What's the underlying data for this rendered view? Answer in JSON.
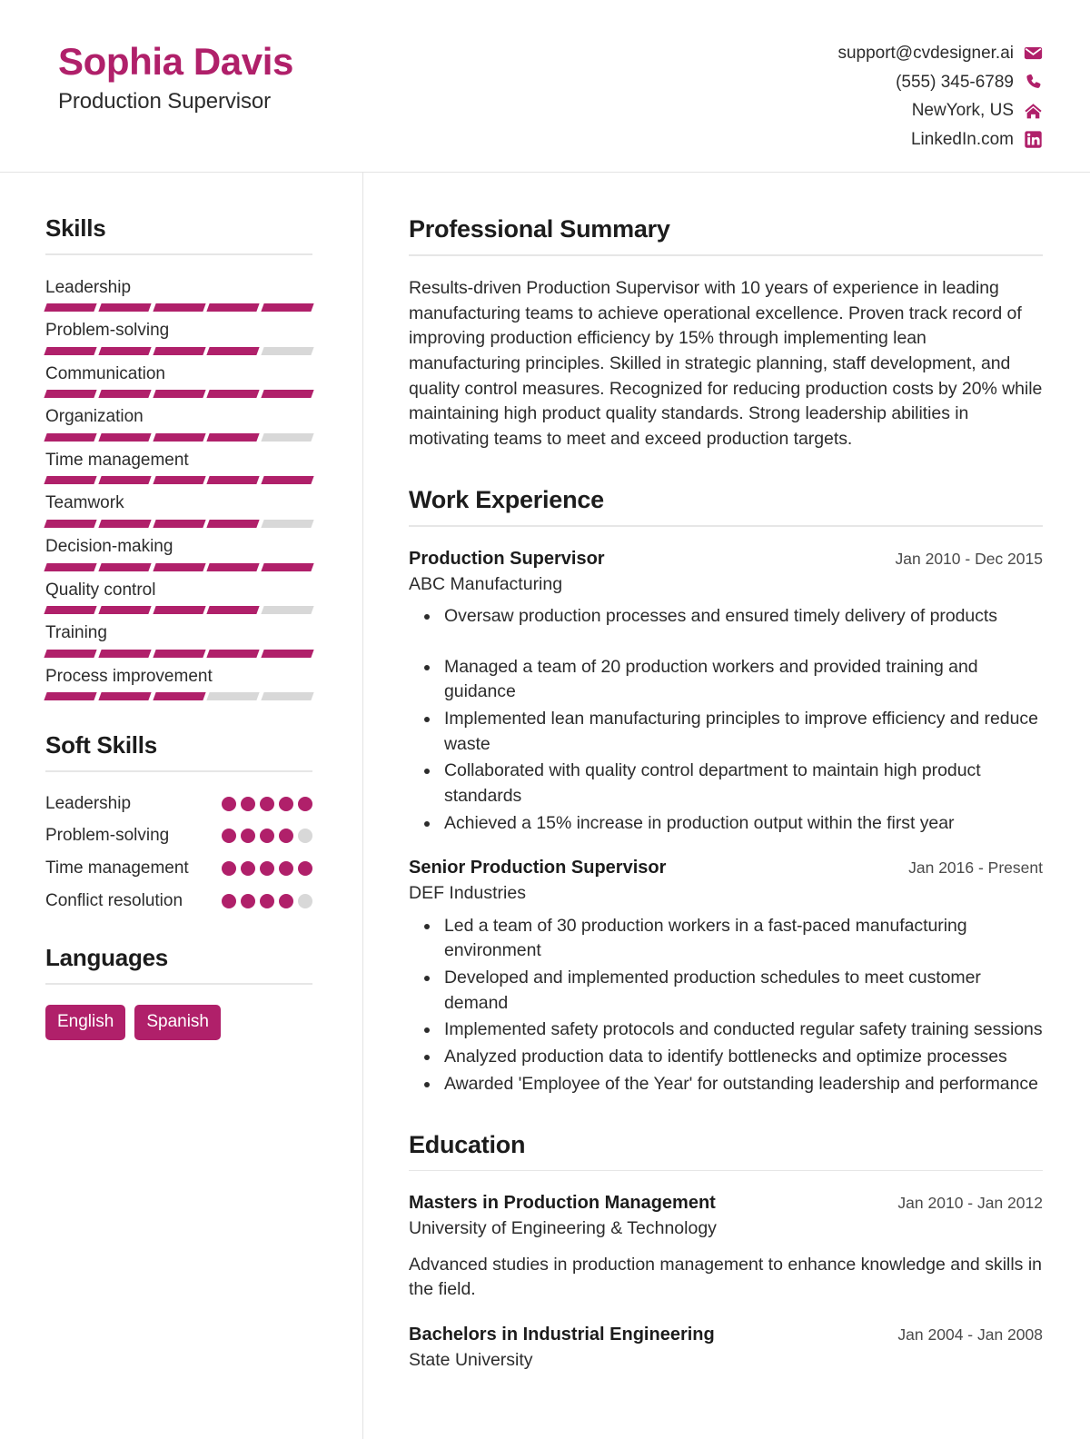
{
  "brand_color": "#b0206a",
  "muted_color": "#d8d8d8",
  "header": {
    "full_name": "Sophia Davis",
    "job_title": "Production Supervisor",
    "contacts": [
      {
        "text": "support@cvdesigner.ai",
        "icon": "envelope-icon"
      },
      {
        "text": "(555) 345-6789",
        "icon": "phone-icon"
      },
      {
        "text": "NewYork, US",
        "icon": "home-icon"
      },
      {
        "text": "LinkedIn.com",
        "icon": "linkedin-icon"
      }
    ]
  },
  "sidebar": {
    "skills": {
      "title": "Skills",
      "max_level": 5,
      "items": [
        {
          "label": "Leadership",
          "level": 5
        },
        {
          "label": "Problem-solving",
          "level": 4
        },
        {
          "label": "Communication",
          "level": 5
        },
        {
          "label": "Organization",
          "level": 4
        },
        {
          "label": "Time management",
          "level": 5
        },
        {
          "label": "Teamwork",
          "level": 4
        },
        {
          "label": "Decision-making",
          "level": 5
        },
        {
          "label": "Quality control",
          "level": 4
        },
        {
          "label": "Training",
          "level": 5
        },
        {
          "label": "Process improvement",
          "level": 3
        }
      ]
    },
    "soft_skills": {
      "title": "Soft Skills",
      "max_level": 5,
      "items": [
        {
          "label": "Leadership",
          "level": 5
        },
        {
          "label": "Problem-solving",
          "level": 4
        },
        {
          "label": "Time management",
          "level": 5
        },
        {
          "label": "Conflict resolution",
          "level": 4
        }
      ]
    },
    "languages": {
      "title": "Languages",
      "items": [
        "English",
        "Spanish"
      ]
    }
  },
  "main": {
    "summary": {
      "title": "Professional Summary",
      "text": "Results-driven Production Supervisor with 10 years of experience in leading manufacturing teams to achieve operational excellence. Proven track record of improving production efficiency by 15% through implementing lean manufacturing principles. Skilled in strategic planning, staff development, and quality control measures. Recognized for reducing production costs by 20% while maintaining high product quality standards. Strong leadership abilities in motivating teams to meet and exceed production targets."
    },
    "work_experience": {
      "title": "Work Experience",
      "entries": [
        {
          "role": "Production Supervisor",
          "date": "Jan 2010 - Dec 2015",
          "organization": "ABC Manufacturing",
          "bullets": [
            "Oversaw production processes and ensured timely delivery of products",
            "Managed a team of 20 production workers and provided training and guidance",
            "Implemented lean manufacturing principles to improve efficiency and reduce waste",
            "Collaborated with quality control department to maintain high product standards",
            "Achieved a 15% increase in production output within the first year"
          ]
        },
        {
          "role": "Senior Production Supervisor",
          "date": "Jan 2016 - Present",
          "organization": "DEF Industries",
          "bullets": [
            "Led a team of 30 production workers in a fast-paced manufacturing environment",
            "Developed and implemented production schedules to meet customer demand",
            "Implemented safety protocols and conducted regular safety training sessions",
            "Analyzed production data to identify bottlenecks and optimize processes",
            "Awarded 'Employee of the Year' for outstanding leadership and performance"
          ]
        }
      ]
    },
    "education": {
      "title": "Education",
      "entries": [
        {
          "degree": "Masters in Production Management",
          "date": "Jan 2010 - Jan 2012",
          "institution": "University of Engineering & Technology",
          "description": "Advanced studies in production management to enhance knowledge and skills in the field."
        },
        {
          "degree": "Bachelors in Industrial Engineering",
          "date": "Jan 2004 - Jan 2008",
          "institution": "State University",
          "description": ""
        }
      ]
    }
  }
}
